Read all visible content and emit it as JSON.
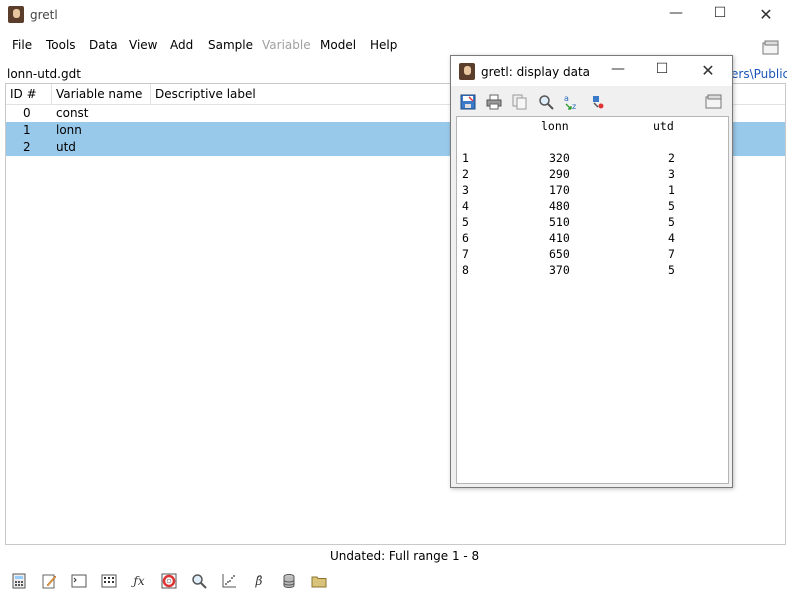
{
  "window": {
    "title": "gretl",
    "minimize_glyph": "—",
    "maximize_glyph": "☐",
    "close_glyph": "✕"
  },
  "menubar": {
    "items": [
      {
        "label": "File",
        "enabled": true
      },
      {
        "label": "Tools",
        "enabled": true
      },
      {
        "label": "Data",
        "enabled": true
      },
      {
        "label": "View",
        "enabled": true
      },
      {
        "label": "Add",
        "enabled": true
      },
      {
        "label": "Sample",
        "enabled": true
      },
      {
        "label": "Variable",
        "enabled": false
      },
      {
        "label": "Model",
        "enabled": true
      },
      {
        "label": "Help",
        "enabled": true
      }
    ]
  },
  "dataset": {
    "filename": "lonn-utd.gdt",
    "path_fragment": "ers\\Public"
  },
  "table": {
    "columns": [
      "ID #",
      "Variable name",
      "Descriptive label"
    ],
    "rows": [
      {
        "id": "0",
        "name": "const",
        "label": "",
        "selected": false
      },
      {
        "id": "1",
        "name": "lonn",
        "label": "",
        "selected": true
      },
      {
        "id": "2",
        "name": "utd",
        "label": "",
        "selected": true
      }
    ]
  },
  "status": {
    "text": "Undated: Full range 1 - 8"
  },
  "bottom_toolbar": {
    "icons": [
      "calculator-icon",
      "edit-script-icon",
      "console-icon",
      "session-icon-view-icon",
      "function-icon",
      "help-lifebuoy-icon",
      "search-icon",
      "scatter-plot-icon",
      "beta-hat-model-icon",
      "database-icon",
      "folder-icon"
    ],
    "fx_label": "ƒx",
    "beta_label": "β̂"
  },
  "display_data": {
    "title": "gretl: display data",
    "toolbar_icons": [
      "save-icon",
      "print-icon",
      "copy-icon",
      "find-icon",
      "sort-icon",
      "edit-values-icon",
      "restore-window-icon"
    ],
    "sort_label": "a z",
    "headers": [
      "lonn",
      "utd"
    ],
    "rows": [
      {
        "obs": "1",
        "lonn": "320",
        "utd": "2"
      },
      {
        "obs": "2",
        "lonn": "290",
        "utd": "3"
      },
      {
        "obs": "3",
        "lonn": "170",
        "utd": "1"
      },
      {
        "obs": "4",
        "lonn": "480",
        "utd": "5"
      },
      {
        "obs": "5",
        "lonn": "510",
        "utd": "5"
      },
      {
        "obs": "6",
        "lonn": "410",
        "utd": "4"
      },
      {
        "obs": "7",
        "lonn": "650",
        "utd": "7"
      },
      {
        "obs": "8",
        "lonn": "370",
        "utd": "5"
      }
    ]
  },
  "colors": {
    "selection": "#99c9ea",
    "link": "#1a56b8",
    "disabled_text": "#a0a0a0"
  }
}
